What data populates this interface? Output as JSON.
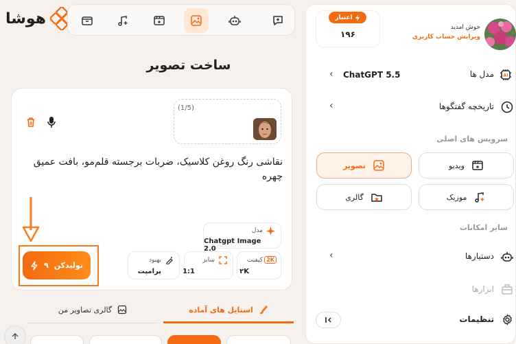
{
  "brand": {
    "name": "هوشا"
  },
  "main": {
    "title": "ساخت تصویر",
    "upload_count": "(1/5)",
    "prompt_text": "نقاشی رنگ روغن کلاسیک، ضربات برجسته قلم‌مو، بافت عمیق چهره",
    "model": {
      "label": "مدل",
      "value": "Chatgpt Image 2.0"
    },
    "quality": {
      "label": "کیفیت",
      "value": "۲K",
      "icon_text": "2K"
    },
    "size": {
      "label": "سایز",
      "value": "1:1"
    },
    "enhance": {
      "label": "بهبود",
      "value": "پرامپت"
    },
    "generate": {
      "label": "تولیدکن",
      "cost": "۹"
    },
    "tabs": [
      {
        "label": "استایل های آماده",
        "icon": "brush-icon",
        "active": true
      },
      {
        "label": "گالری تصاویر من",
        "icon": "image-icon",
        "active": false
      }
    ],
    "style_chips": [
      "",
      "",
      "",
      "",
      ""
    ]
  },
  "sidebar": {
    "credit": {
      "label": "اعتبار",
      "value": "۱۹۶"
    },
    "user": {
      "welcome": "خوش امدید",
      "edit_account": "ویرایش حساب کاربری"
    },
    "models_row": {
      "label": "مدل ها",
      "value": "ChatGPT 5.5"
    },
    "history_row": {
      "label": "تاریخچه گفتگوها"
    },
    "main_services_title": "سرویس های اصلی",
    "services": [
      {
        "label": "تصویر",
        "icon": "image-gen-icon",
        "active": true
      },
      {
        "label": "ویدیو",
        "icon": "video-icon",
        "active": false
      },
      {
        "label": "گالری",
        "icon": "gallery-icon",
        "active": false
      },
      {
        "label": "موزیک",
        "icon": "music-icon",
        "active": false
      }
    ],
    "other_title": "سایر امکانات",
    "assistants_row": {
      "label": "دستیارها"
    },
    "tools_row": {
      "label": "ابزارها"
    },
    "settings_row": {
      "label": "تنظیمات"
    }
  },
  "colors": {
    "accent": "#f26b12",
    "active_bg": "#fff3ea",
    "page_bg": "#f6f1ec"
  }
}
